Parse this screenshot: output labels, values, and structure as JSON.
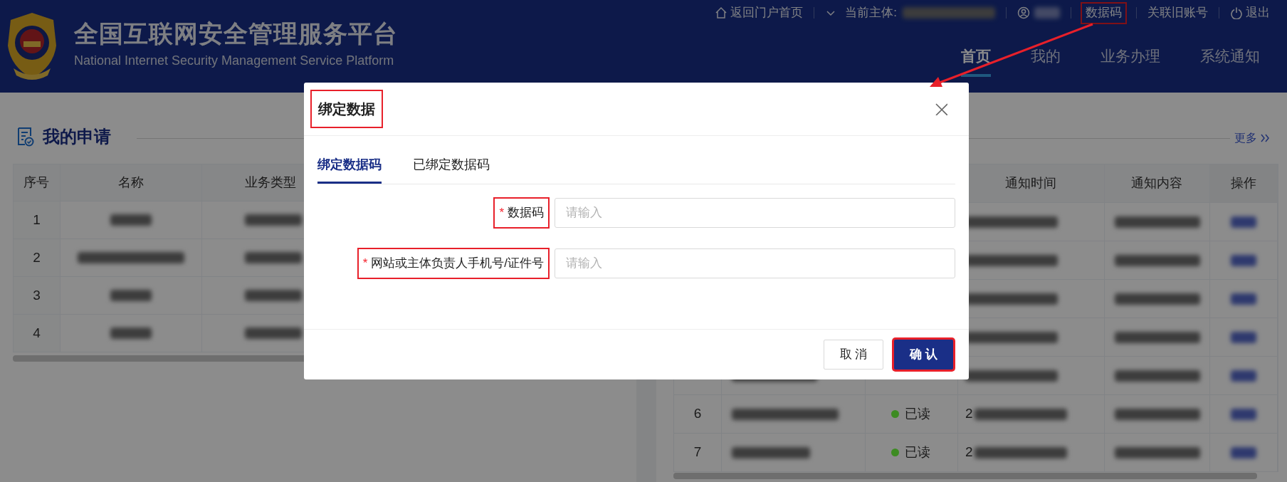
{
  "header": {
    "title": "全国互联网安全管理服务平台",
    "subtitle": "National Internet Security Management Service Platform",
    "top_links": [
      {
        "kind": "home",
        "label": "返回门户首页",
        "highlighted": false
      },
      {
        "kind": "entity",
        "label": "当前主体:",
        "highlighted": false
      },
      {
        "kind": "user",
        "highlighted": false
      },
      {
        "kind": "text",
        "label": "数据码",
        "highlighted": true
      },
      {
        "kind": "text",
        "label": "关联旧账号",
        "highlighted": false
      },
      {
        "kind": "logout",
        "label": "退出",
        "highlighted": false
      }
    ],
    "nav": [
      {
        "label": "首页",
        "selected": true
      },
      {
        "label": "我的",
        "selected": false
      },
      {
        "label": "业务办理",
        "selected": false
      },
      {
        "label": "系统通知",
        "selected": false
      }
    ]
  },
  "applications": {
    "title": "我的申请",
    "columns": [
      "序号",
      "名称",
      "业务类型"
    ],
    "rows": [
      {
        "index": "1"
      },
      {
        "index": "2"
      },
      {
        "index": "3"
      },
      {
        "index": "4"
      }
    ]
  },
  "notifications": {
    "more": "更多",
    "columns": [
      "通知时间",
      "通知内容",
      "操作"
    ],
    "rows": [
      {
        "index": "6",
        "status": "已读",
        "color": "#3d8b22",
        "time": "2"
      },
      {
        "index": "7",
        "status": "已读",
        "color": "#3d8b22",
        "time": "2"
      }
    ]
  },
  "dialog": {
    "title": "绑定数据",
    "title_highlighted": true,
    "tabs": [
      {
        "label": "绑定数据码",
        "selected": true
      },
      {
        "label": "已绑定数据码",
        "selected": false
      }
    ],
    "fields": [
      {
        "label": "数据码",
        "required": true,
        "required_mark": "*",
        "placeholder": "请输入",
        "highlighted": true
      },
      {
        "label": "网站或主体负责人手机号/证件号",
        "required": true,
        "required_mark": "*",
        "placeholder": "请输入",
        "highlighted": true
      }
    ],
    "buttons": [
      {
        "kind": "secondary",
        "label": "取 消",
        "highlighted": false
      },
      {
        "kind": "primary",
        "label": "确 认",
        "highlighted": true
      }
    ]
  }
}
